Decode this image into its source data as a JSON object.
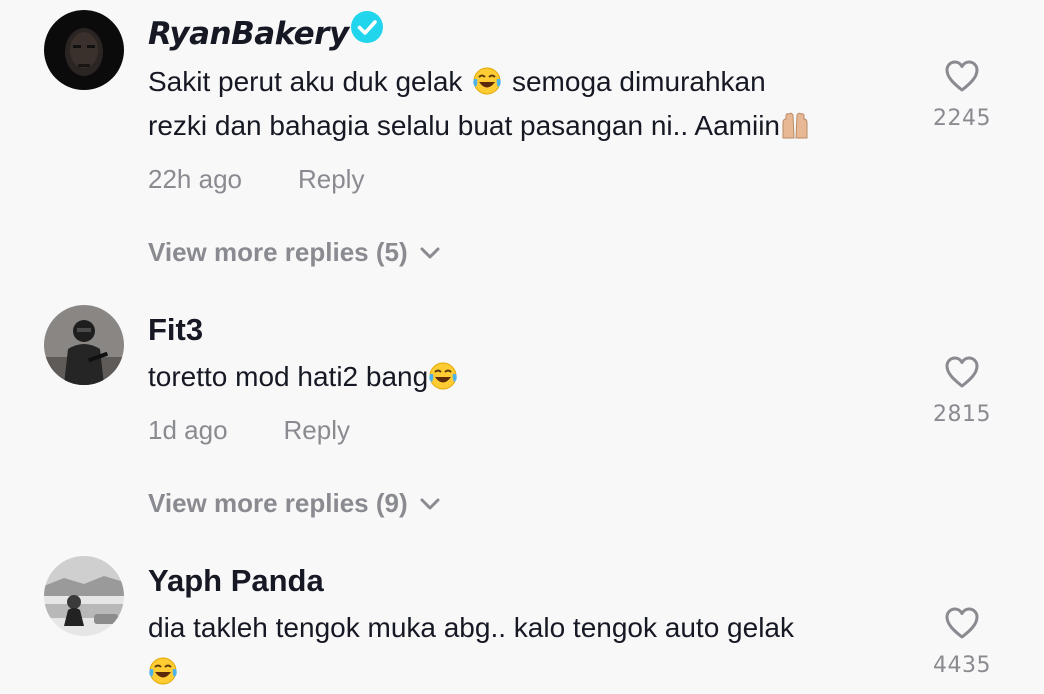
{
  "comments": [
    {
      "username": "RyanBakery",
      "verified": true,
      "text_line1_a": "Sakit perut aku duk gelak",
      "text_line1_b": "semoga dimurahkan",
      "text_line2": "rezki dan bahagia selalu buat pasangan ni.. Aamiin",
      "time": "22h ago",
      "reply_label": "Reply",
      "likes": "2245",
      "view_more": "View more replies (5)"
    },
    {
      "username": "Fit3",
      "verified": false,
      "text": "toretto mod hati2 bang",
      "time": "1d ago",
      "reply_label": "Reply",
      "likes": "2815",
      "view_more": "View more replies (9)"
    },
    {
      "username": "Yaph Panda",
      "verified": false,
      "text": "dia takleh tengok muka abg.. kalo tengok auto gelak",
      "likes": "4435"
    }
  ],
  "icons": {
    "like": "heart-outline-icon",
    "verified": "verified-check-icon",
    "expand": "chevron-down-icon",
    "emoji_laugh": "tears-of-joy-emoji",
    "emoji_hands": "palms-up-together-emoji"
  },
  "colors": {
    "verified": "#20d5ec",
    "muted": "#8a8b91",
    "text": "#161823"
  }
}
